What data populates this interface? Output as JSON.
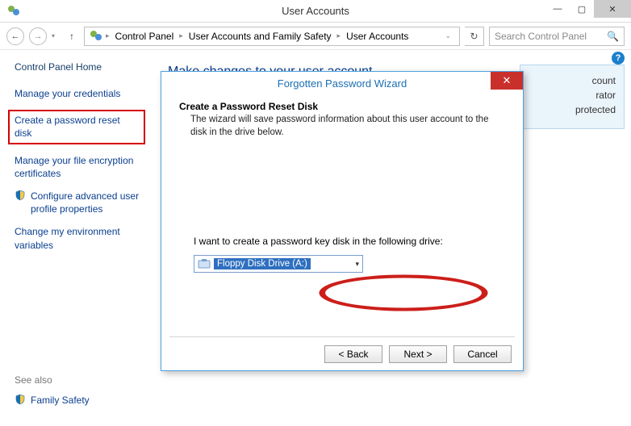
{
  "window": {
    "title": "User Accounts",
    "min": "—",
    "max": "▢",
    "close": "✕"
  },
  "nav": {
    "back": "←",
    "forward": "→",
    "up": "↑",
    "breadcrumb": [
      "Control Panel",
      "User Accounts and Family Safety",
      "User Accounts"
    ],
    "refresh": "↻",
    "search_placeholder": "Search Control Panel"
  },
  "help": "?",
  "sidebar": {
    "home": "Control Panel Home",
    "links": [
      "Manage your credentials",
      "Create a password reset disk",
      "Manage your file encryption certificates",
      "Configure advanced user profile properties",
      "Change my environment variables"
    ],
    "seealso_hdr": "See also",
    "seealso_link": "Family Safety"
  },
  "mainpane": {
    "heading": "Make changes to your user account"
  },
  "infocard": {
    "l1": "count",
    "l2": "rator",
    "l3": "protected"
  },
  "dialog": {
    "title": "Forgotten Password Wizard",
    "close": "✕",
    "heading": "Create a Password Reset Disk",
    "sub": "The wizard will save password information about this user account to the disk in the drive below.",
    "prompt": "I want to create a password key disk in the following drive:",
    "drive": "Floppy Disk Drive (A:)",
    "btn_back": "< Back",
    "btn_next": "Next >",
    "btn_cancel": "Cancel"
  }
}
